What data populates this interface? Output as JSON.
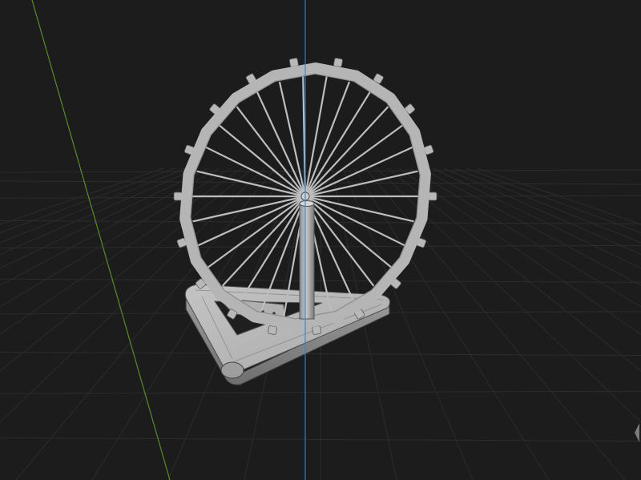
{
  "viewport": {
    "kind": "3d-viewport",
    "background_color": "#1c1c1c",
    "grid_color": "#2c2c2c",
    "x_axis_color": "#5a8a2e",
    "z_axis_color": "#3a7fd0",
    "model_color": "#b8b8b8",
    "model_dark_color": "#7e7e7e"
  },
  "model": {
    "name": "ferris-wheel",
    "spoke_count": 30,
    "rim_bump_count": 18,
    "parts": [
      "rim",
      "spokes",
      "hub",
      "support-column",
      "triangular-base"
    ]
  }
}
